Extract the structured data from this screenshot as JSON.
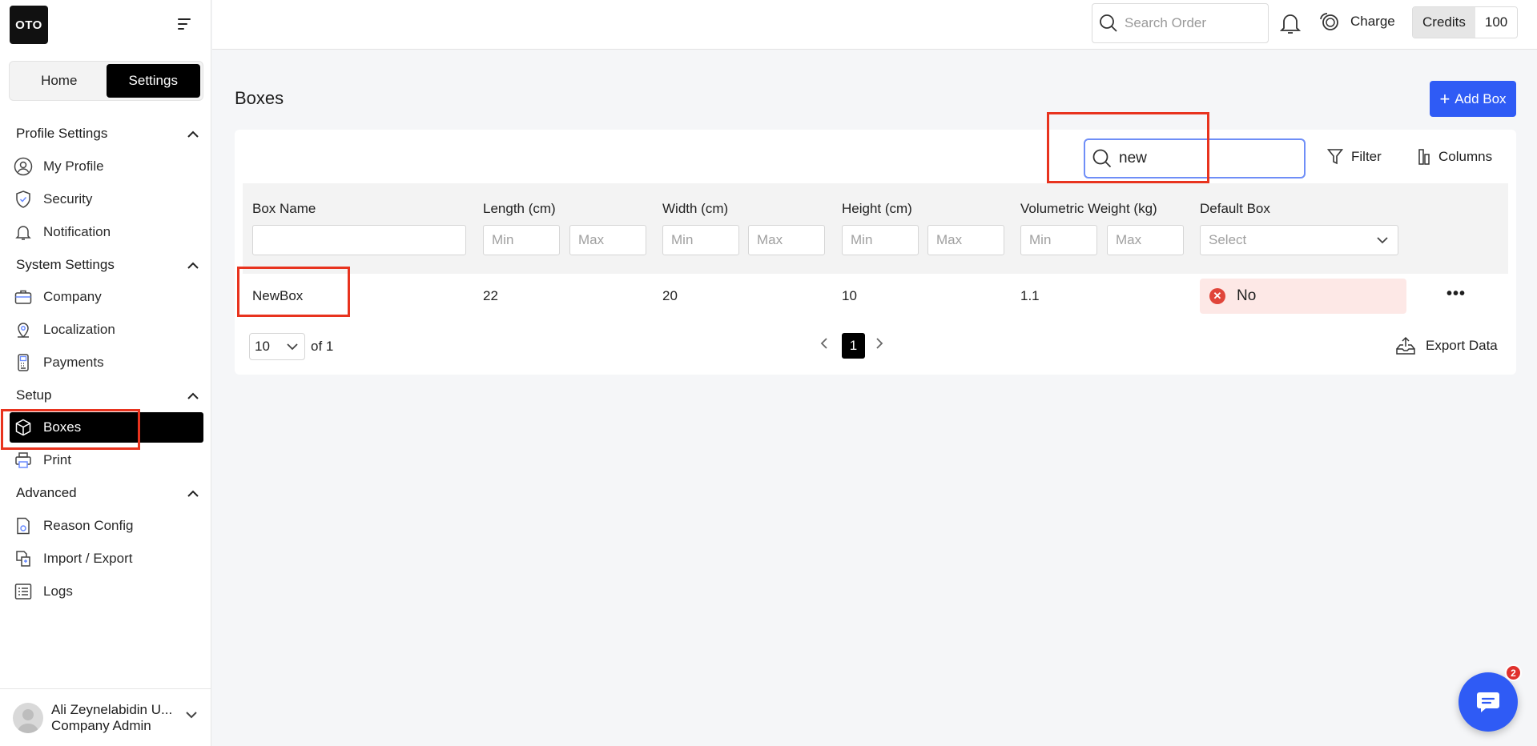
{
  "brand": {
    "logo_text": "OTO"
  },
  "segment": {
    "home": "Home",
    "settings": "Settings"
  },
  "sidebar": {
    "sections": [
      {
        "title": "Profile Settings",
        "items": [
          "My Profile",
          "Security",
          "Notification"
        ]
      },
      {
        "title": "System Settings",
        "items": [
          "Company",
          "Localization",
          "Payments"
        ]
      },
      {
        "title": "Setup",
        "items": [
          "Boxes",
          "Print"
        ]
      },
      {
        "title": "Advanced",
        "items": [
          "Reason Config",
          "Import / Export",
          "Logs"
        ]
      }
    ],
    "active_item": "Boxes"
  },
  "user": {
    "name": "Ali Zeynelabidin U...",
    "role": "Company Admin"
  },
  "topbar": {
    "search_placeholder": "Search Order",
    "charge_label": "Charge",
    "credits_label": "Credits",
    "credits_value": "100"
  },
  "page": {
    "title": "Boxes",
    "add_button": "Add Box"
  },
  "toolbar": {
    "search_value": "new",
    "filter_label": "Filter",
    "columns_label": "Columns"
  },
  "table": {
    "headers": [
      "Box Name",
      "Length (cm)",
      "Width (cm)",
      "Height (cm)",
      "Volumetric Weight (kg)",
      "Default Box"
    ],
    "filter_min": "Min",
    "filter_max": "Max",
    "filter_select": "Select",
    "rows": [
      {
        "box_name": "NewBox",
        "length": "22",
        "width": "20",
        "height": "10",
        "vol_weight": "1.1",
        "default": "No"
      }
    ]
  },
  "pagination": {
    "page_size": "10",
    "of_text": "of 1",
    "current_page": "1",
    "export_label": "Export Data"
  },
  "chat": {
    "badge": "2"
  },
  "colors": {
    "accent": "#2f5bf5",
    "highlight": "#e8331e",
    "danger": "#e0453a"
  }
}
